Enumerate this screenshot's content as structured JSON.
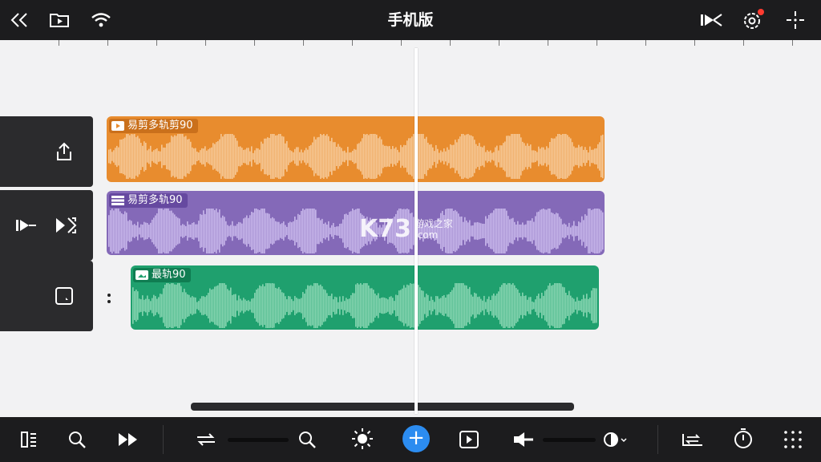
{
  "header": {
    "title": "手机版"
  },
  "tracks": [
    {
      "clip_label": "易剪多轨剪90",
      "color": "#e88c2e",
      "wave_color": "#f6c896"
    },
    {
      "clip_label": "易剪多轨90",
      "color": "#8469b8",
      "wave_color": "#c7b6ea"
    },
    {
      "clip_label": "最轨90",
      "color": "#1fa06e",
      "wave_color": "#86d4b0"
    }
  ],
  "toolbar": {
    "add_label": "+"
  },
  "watermark": {
    "brand": "K73",
    "line1": "游戏之家",
    "line2": ".com"
  },
  "colors": {
    "accent": "#2c8cf0",
    "bar": "#1c1c1e",
    "notify": "#ff3b30"
  },
  "icons": [
    "double-chevron-left-icon",
    "media-browser-icon",
    "wifi-icon",
    "play-from-icon",
    "settings-gear-icon",
    "more-icon",
    "share-icon",
    "play-clip-icon",
    "expand-icon",
    "track-menu-icon",
    "split-icon",
    "search-icon",
    "fast-forward-icon",
    "loop-icon",
    "zoom-icon",
    "brightness-icon",
    "play-icon",
    "volume-icon",
    "contrast-icon",
    "timeline-icon",
    "timer-icon",
    "grid-icon"
  ]
}
